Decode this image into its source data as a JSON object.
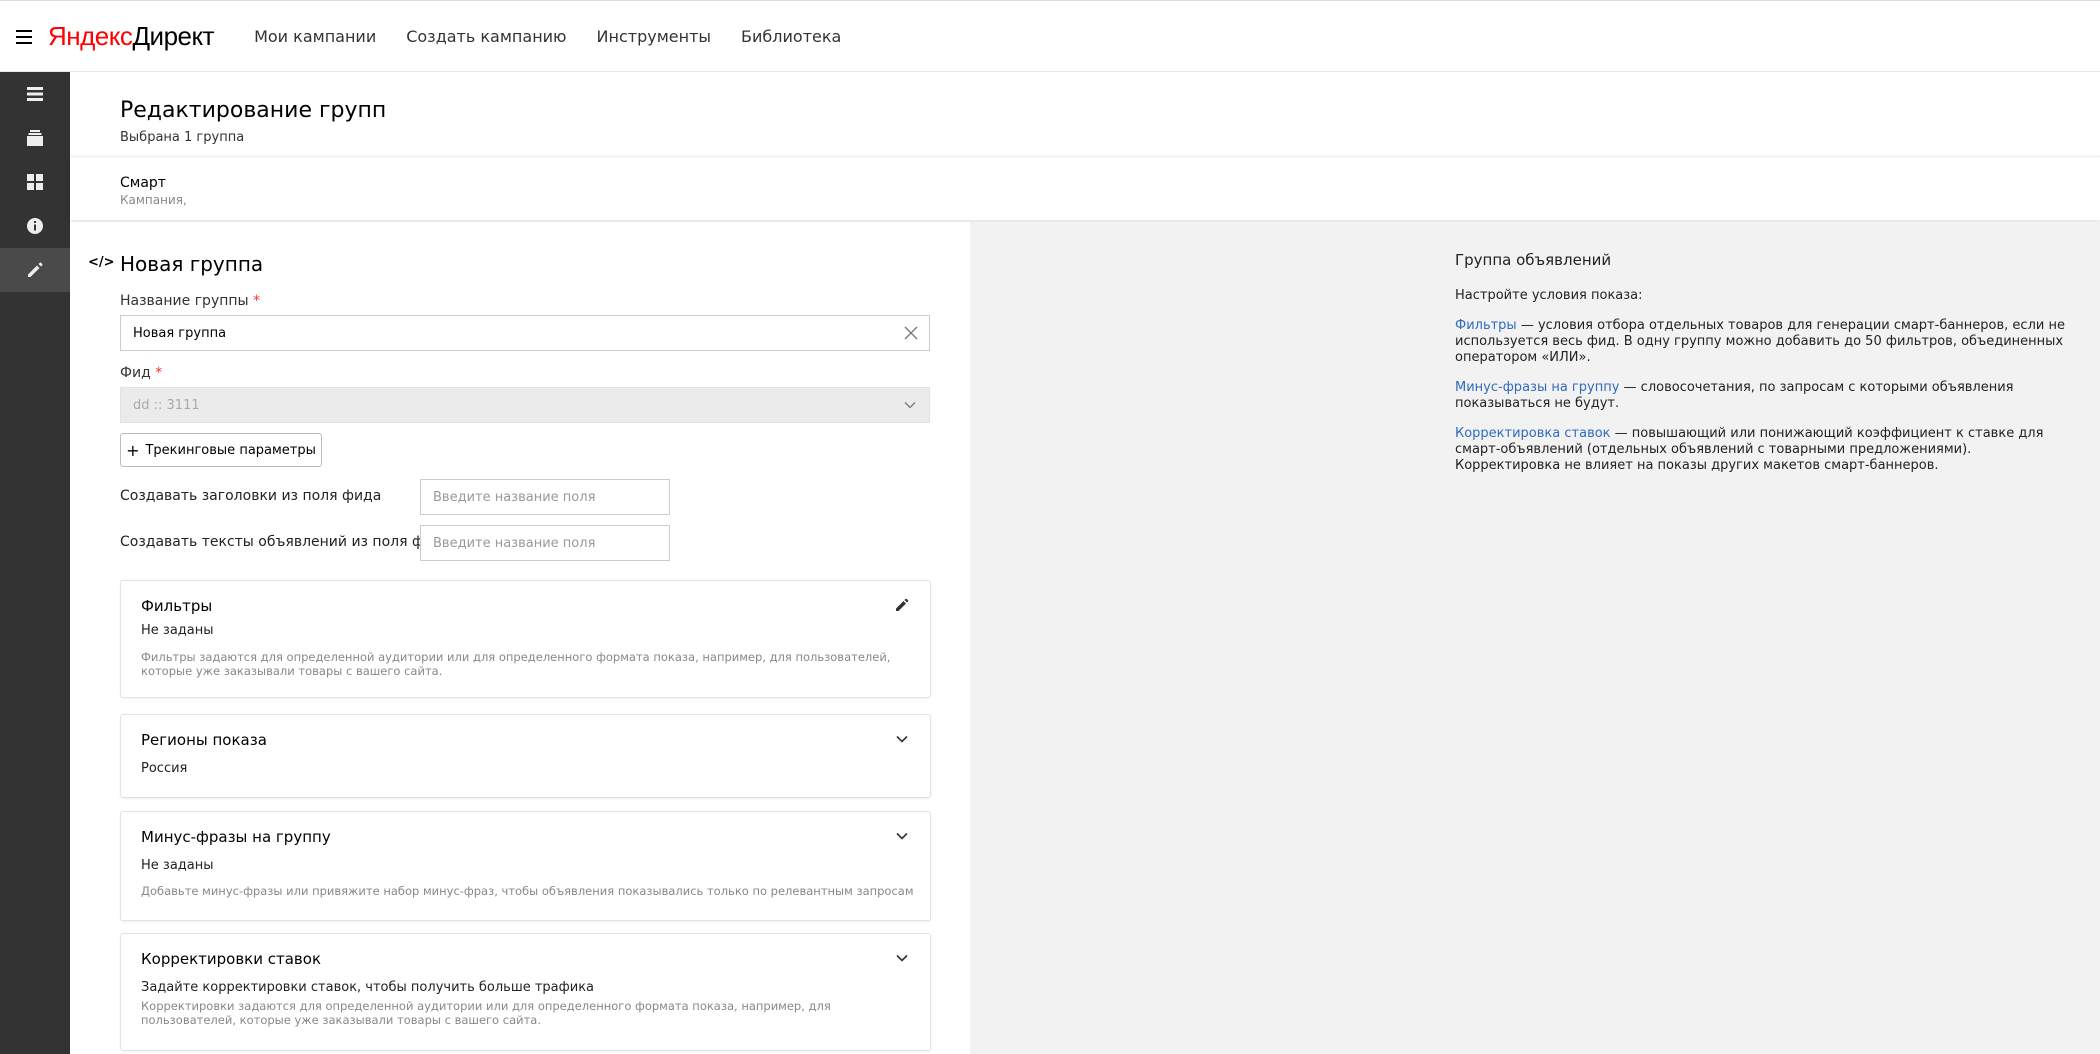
{
  "header": {
    "logo_ya": "Яндекс",
    "logo_rest": "Директ",
    "nav": [
      "Мои кампании",
      "Создать кампанию",
      "Инструменты",
      "Библиотека"
    ]
  },
  "page": {
    "title": "Редактирование групп",
    "subtitle": "Выбрана 1 группа",
    "campaign_name": "Смарт",
    "campaign_label": "Кампания,"
  },
  "form": {
    "group_title": "Новая группа",
    "name_label": "Название группы",
    "name_value": "Новая группа",
    "feed_label": "Фид",
    "feed_value": "dd :: 3111",
    "tracking_button": "Трекинговые параметры",
    "headlines_label": "Создавать заголовки из поля фида",
    "headlines_placeholder": "Введите название поля",
    "texts_label": "Создавать тексты объявлений из поля фида",
    "texts_placeholder": "Введите название поля",
    "required_mark": "*"
  },
  "cards": {
    "filters": {
      "title": "Фильтры",
      "value": "Не заданы",
      "desc": "Фильтры задаются для определенной аудитории или для определенного формата показа, например, для пользователей, которые уже заказывали товары с вашего сайта."
    },
    "regions": {
      "title": "Регионы показа",
      "value": "Россия"
    },
    "minus": {
      "title": "Минус-фразы на группу",
      "value": "Не заданы",
      "desc": "Добавьте минус-фразы или привяжите набор минус-фраз, чтобы объявления показывались только по релевантным запросам"
    },
    "bids": {
      "title": "Корректировки ставок",
      "value": "Задайте корректировки ставок, чтобы получить больше трафика",
      "desc": "Корректировки задаются для определенной аудитории или для определенного формата показа, например, для пользователей, которые уже заказывали товары с вашего сайта."
    }
  },
  "help": {
    "title": "Группа объявлений",
    "intro": "Настройте условия показа:",
    "filters_link": "Фильтры",
    "filters_text": " — условия отбора отдельных товаров для генерации смарт-баннеров, если не используется весь фид. В одну группу можно добавить до 50 фильтров, объединенных оператором «ИЛИ».",
    "minus_link": "Минус-фразы на группу",
    "minus_text": " — словосочетания, по запросам с которыми объявления показываться не будут.",
    "bids_link": "Корректировка ставок",
    "bids_text": " — повышающий или понижающий коэффициент к ставке для смарт-объявлений (отдельных объявлений с товарными предложениями). Корректировка не влияет на показы других макетов смарт-баннеров."
  },
  "icons": {
    "sidebar": [
      "list-icon",
      "layers-icon",
      "grid-icon",
      "info-icon",
      "pencil-icon"
    ],
    "code": "code-icon"
  },
  "colors": {
    "sidebar_bg": "#333333",
    "link": "#2e6cbf",
    "required": "#ff3333",
    "right_pane_bg": "#f2f2f2"
  }
}
